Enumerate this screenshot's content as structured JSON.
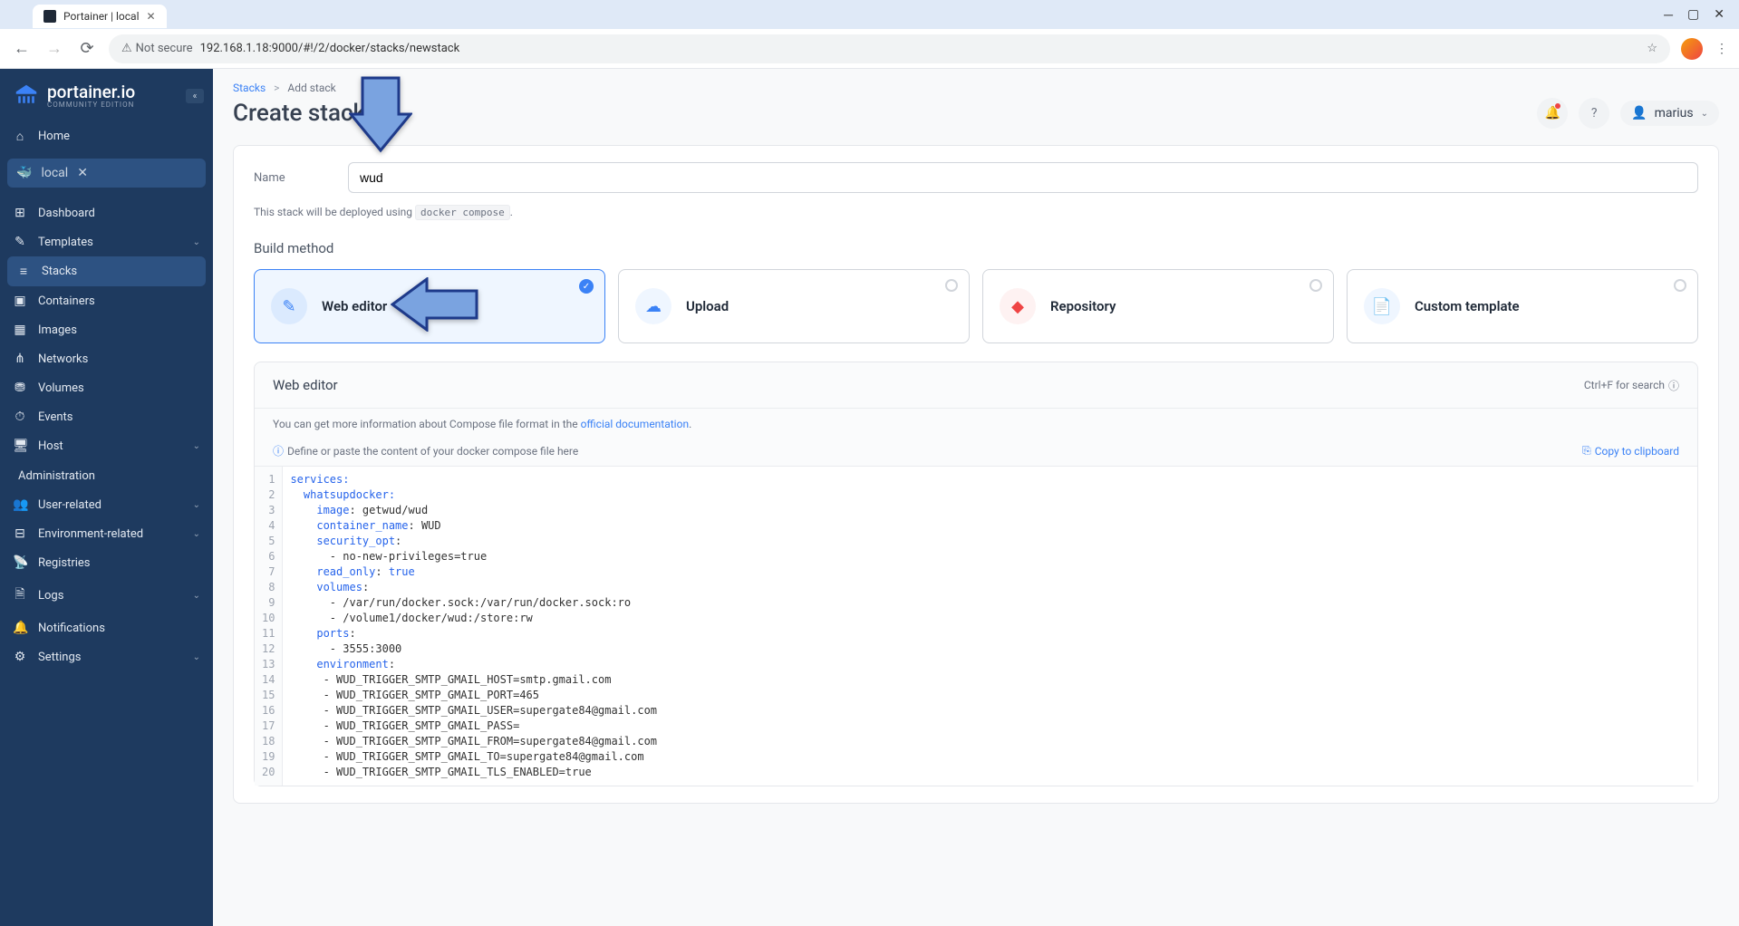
{
  "browser": {
    "tab_title": "Portainer | local",
    "url": "192.168.1.18:9000/#!/2/docker/stacks/newstack",
    "not_secure": "Not secure"
  },
  "sidebar": {
    "logo_title": "portainer.io",
    "logo_sub": "COMMUNITY EDITION",
    "home": "Home",
    "env": "local",
    "items": [
      {
        "icon": "dashboard",
        "label": "Dashboard"
      },
      {
        "icon": "templates",
        "label": "Templates",
        "chev": true
      },
      {
        "icon": "stacks",
        "label": "Stacks",
        "active": true
      },
      {
        "icon": "containers",
        "label": "Containers"
      },
      {
        "icon": "images",
        "label": "Images"
      },
      {
        "icon": "networks",
        "label": "Networks"
      },
      {
        "icon": "volumes",
        "label": "Volumes"
      },
      {
        "icon": "events",
        "label": "Events"
      },
      {
        "icon": "host",
        "label": "Host",
        "chev": true
      }
    ],
    "admin_title": "Administration",
    "admin_items": [
      {
        "icon": "users",
        "label": "User-related",
        "chev": true
      },
      {
        "icon": "env",
        "label": "Environment-related",
        "chev": true
      },
      {
        "icon": "registries",
        "label": "Registries"
      },
      {
        "icon": "logs",
        "label": "Logs",
        "chev": true
      },
      {
        "icon": "notif",
        "label": "Notifications"
      },
      {
        "icon": "settings",
        "label": "Settings",
        "chev": true
      }
    ]
  },
  "header": {
    "crumb_stacks": "Stacks",
    "crumb_sep": ">",
    "crumb_current": "Add stack",
    "title": "Create stack",
    "user": "marius"
  },
  "form": {
    "name_label": "Name",
    "name_value": "wud",
    "helper_pre": "This stack will be deployed using ",
    "helper_code": "docker compose",
    "helper_post": ".",
    "build_method": "Build method",
    "methods": [
      {
        "title": "Web editor",
        "selected": true
      },
      {
        "title": "Upload"
      },
      {
        "title": "Repository"
      },
      {
        "title": "Custom template"
      }
    ]
  },
  "editor": {
    "title": "Web editor",
    "search_hint": "Ctrl+F for search",
    "help_pre": "You can get more information about Compose file format in the ",
    "help_link": "official documentation",
    "placeholder_hint": "Define or paste the content of your docker compose file here",
    "copy": "Copy to clipboard",
    "code": {
      "l1": "services:",
      "l2": "  whatsupdocker:",
      "l3a": "    image",
      "l3b": ": getwud/wud",
      "l4a": "    container_name",
      "l4b": ": WUD",
      "l5a": "    security_opt",
      "l5b": ":",
      "l6": "      - no-new-privileges=true",
      "l7a": "    read_only",
      "l7b": ": ",
      "l7c": "true",
      "l8a": "    volumes",
      "l8b": ":",
      "l9": "      - /var/run/docker.sock:/var/run/docker.sock:ro",
      "l10": "      - /volume1/docker/wud:/store:rw",
      "l11a": "    ports",
      "l11b": ":",
      "l12": "      - 3555:3000",
      "l13a": "    environment",
      "l13b": ":",
      "l14": "     - WUD_TRIGGER_SMTP_GMAIL_HOST=smtp.gmail.com",
      "l15": "     - WUD_TRIGGER_SMTP_GMAIL_PORT=465",
      "l16": "     - WUD_TRIGGER_SMTP_GMAIL_USER=supergate84@gmail.com",
      "l17": "     - WUD_TRIGGER_SMTP_GMAIL_PASS=",
      "l18": "     - WUD_TRIGGER_SMTP_GMAIL_FROM=supergate84@gmail.com",
      "l19": "     - WUD_TRIGGER_SMTP_GMAIL_TO=supergate84@gmail.com",
      "l20": "     - WUD_TRIGGER_SMTP_GMAIL_TLS_ENABLED=true"
    }
  }
}
